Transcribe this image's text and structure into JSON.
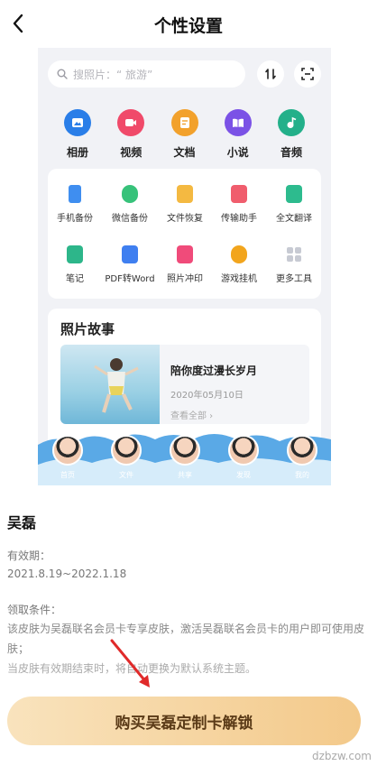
{
  "header": {
    "title": "个性设置"
  },
  "preview": {
    "search": {
      "placeholder": "搜照片：“ 旅游”"
    },
    "categories": [
      {
        "label": "相册",
        "color": "#2a7ee8",
        "icon": "album-icon"
      },
      {
        "label": "视频",
        "color": "#f04a6a",
        "icon": "video-icon"
      },
      {
        "label": "文档",
        "color": "#f2a12c",
        "icon": "document-icon"
      },
      {
        "label": "小说",
        "color": "#7b52e6",
        "icon": "novel-icon"
      },
      {
        "label": "音频",
        "color": "#23b08a",
        "icon": "audio-icon"
      }
    ],
    "tools": [
      {
        "label": "手机备份",
        "color": "#3f8ef0"
      },
      {
        "label": "微信备份",
        "color": "#37c27a"
      },
      {
        "label": "文件恢复",
        "color": "#f4b941"
      },
      {
        "label": "传输助手",
        "color": "#f05d6d"
      },
      {
        "label": "全文翻译",
        "color": "#2dbb8e"
      },
      {
        "label": "笔记",
        "color": "#2db68a"
      },
      {
        "label": "PDF转Word",
        "color": "#3f7ff0"
      },
      {
        "label": "照片冲印",
        "color": "#f04b7a"
      },
      {
        "label": "游戏挂机",
        "color": "#f2a51d"
      },
      {
        "label": "更多工具",
        "color": "#c7cad3"
      }
    ],
    "story": {
      "title": "照片故事",
      "name": "陪你度过漫长岁月",
      "date": "2020年05月10日",
      "view_all": "查看全部 ›"
    },
    "tabs": [
      "首页",
      "文件",
      "共享",
      "发现",
      "我的"
    ]
  },
  "skin": {
    "name": "吴磊",
    "validity_label": "有效期：",
    "validity_value": "2021.8.19~2022.1.18",
    "condition_label": "领取条件：",
    "condition_text": "该皮肤为吴磊联名会员卡专享皮肤，激活吴磊联名会员卡的用户即可使用皮肤；",
    "expiry_text": "当皮肤有效期结束时，将自动更换为默认系统主题。"
  },
  "buy_button": "购买吴磊定制卡解锁",
  "watermark": "dzbzw.com"
}
